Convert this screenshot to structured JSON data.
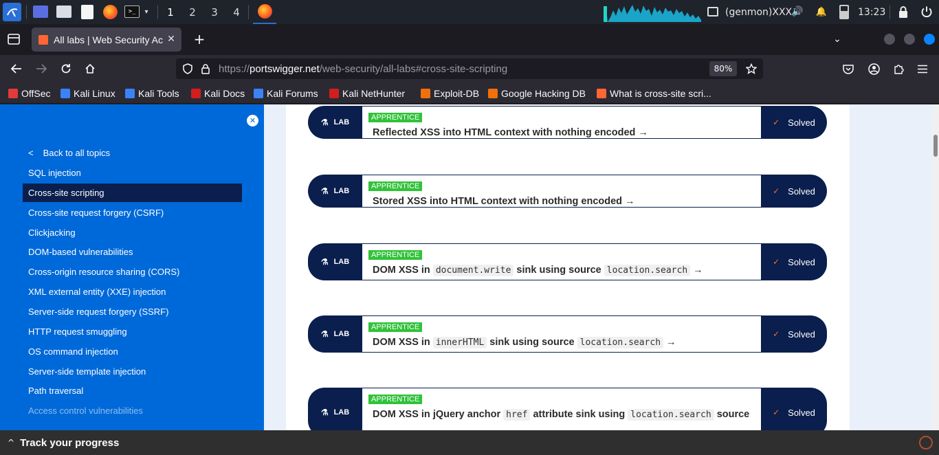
{
  "taskbar": {
    "workspaces": [
      "1",
      "2",
      "3",
      "4"
    ],
    "genmon": "(genmon)XXX",
    "clock": "13:23"
  },
  "browser": {
    "tab_title": "All labs | Web Security Ac",
    "url_prefix": "https://",
    "url_host": "portswigger.net",
    "url_path": "/web-security/all-labs#cross-site-scripting",
    "zoom": "80%",
    "new_tab": "+",
    "tab_close": "✕"
  },
  "bookmarks": [
    {
      "label": "OffSec",
      "color": "#e23b3b"
    },
    {
      "label": "Kali Linux",
      "color": "#3b82f6"
    },
    {
      "label": "Kali Tools",
      "color": "#3b82f6"
    },
    {
      "label": "Kali Docs",
      "color": "#d21e1e"
    },
    {
      "label": "Kali Forums",
      "color": "#3b82f6"
    },
    {
      "label": "Kali NetHunter",
      "color": "#d21e1e"
    },
    {
      "label": "Exploit-DB",
      "color": "#f2700b"
    },
    {
      "label": "Google Hacking DB",
      "color": "#f2700b"
    },
    {
      "label": "What is cross-site scri...",
      "color": "#ff6633"
    }
  ],
  "sidebar": {
    "back_label": "Back to all topics",
    "topics": [
      {
        "label": "SQL injection"
      },
      {
        "label": "Cross-site scripting"
      },
      {
        "label": "Cross-site request forgery (CSRF)"
      },
      {
        "label": "Clickjacking"
      },
      {
        "label": "DOM-based vulnerabilities"
      },
      {
        "label": "Cross-origin resource sharing (CORS)"
      },
      {
        "label": "XML external entity (XXE) injection"
      },
      {
        "label": "Server-side request forgery (SSRF)"
      },
      {
        "label": "HTTP request smuggling"
      },
      {
        "label": "OS command injection"
      },
      {
        "label": "Server-side template injection"
      },
      {
        "label": "Path traversal"
      },
      {
        "label": "Access control vulnerabilities"
      }
    ],
    "active_index": 1
  },
  "labs": [
    {
      "tag": "LAB",
      "level": "APPRENTICE",
      "status": "Solved",
      "parts": [
        {
          "t": "text",
          "v": "Reflected XSS into HTML context with nothing encoded"
        }
      ]
    },
    {
      "tag": "LAB",
      "level": "APPRENTICE",
      "status": "Solved",
      "parts": [
        {
          "t": "text",
          "v": "Stored XSS into HTML context with nothing encoded"
        }
      ]
    },
    {
      "tag": "LAB",
      "level": "APPRENTICE",
      "status": "Solved",
      "parts": [
        {
          "t": "text",
          "v": "DOM XSS in "
        },
        {
          "t": "code",
          "v": "document.write"
        },
        {
          "t": "text",
          "v": " sink using source "
        },
        {
          "t": "code",
          "v": "location.search"
        }
      ]
    },
    {
      "tag": "LAB",
      "level": "APPRENTICE",
      "status": "Solved",
      "parts": [
        {
          "t": "text",
          "v": "DOM XSS in "
        },
        {
          "t": "code",
          "v": "innerHTML"
        },
        {
          "t": "text",
          "v": " sink using source "
        },
        {
          "t": "code",
          "v": "location.search"
        }
      ]
    },
    {
      "tag": "LAB",
      "level": "APPRENTICE",
      "status": "Solved",
      "parts": [
        {
          "t": "text",
          "v": "DOM XSS in jQuery anchor "
        },
        {
          "t": "code",
          "v": "href"
        },
        {
          "t": "text",
          "v": " attribute sink using "
        },
        {
          "t": "code",
          "v": "location.search"
        },
        {
          "t": "text",
          "v": " source"
        }
      ]
    }
  ],
  "progress": {
    "label": "Track your progress"
  },
  "colors": {
    "sidebar": "#0069d9",
    "navy": "#0a1f4d",
    "badge": "#31c23a",
    "accent": "#ff6633"
  }
}
